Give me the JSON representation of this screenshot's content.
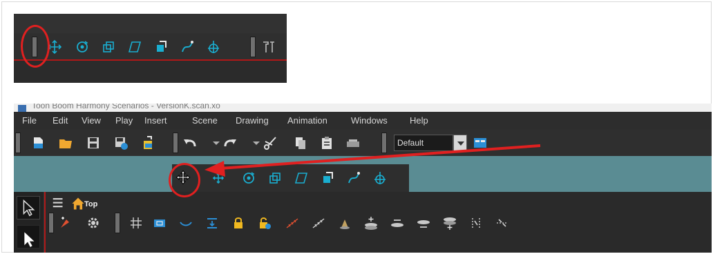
{
  "window": {
    "title": "Toon Boom Harmony Scenarios - VersionK.scan.xo"
  },
  "menu": [
    "File",
    "Edit",
    "View",
    "Play",
    "Insert",
    "Scene",
    "Drawing",
    "Animation",
    "Windows",
    "Help"
  ],
  "toolbar": {
    "workspace_dropdown": {
      "value": "Default"
    }
  },
  "camera_toolbar": {
    "icons": [
      "move-icon",
      "rotate-icon",
      "scale-icon",
      "skew-icon",
      "maintain-size-icon",
      "spline-offset-icon",
      "animate-icon"
    ]
  },
  "node_view": {
    "breadcrumb": "Top"
  },
  "colors": {
    "annotation": "#e02020",
    "tool_accent": "#00a7c6",
    "teal_area": "#5a8c93"
  }
}
